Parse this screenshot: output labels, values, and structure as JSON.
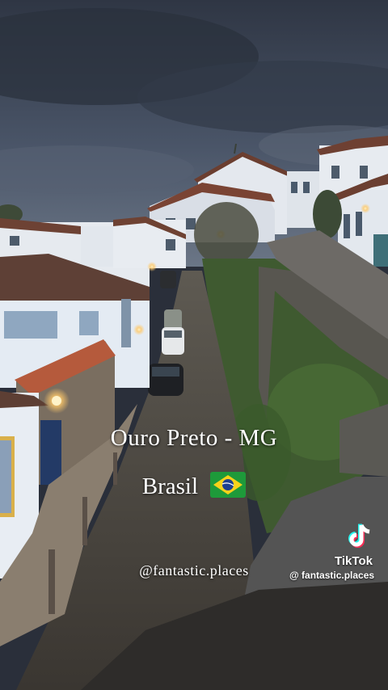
{
  "overlay": {
    "title": "Ouro Preto - MG",
    "country": "Brasil",
    "flag_icon": "brazil-flag-emoji",
    "handle": "@fantastic.places"
  },
  "watermark": {
    "brand": "TikTok",
    "username": "@ fantastic.places",
    "logo_icon": "tiktok-logo"
  },
  "colors": {
    "sky": "#3a4658",
    "wall_white": "#e9eef4",
    "roof_tile": "#7a4a38",
    "stone": "#5a5650",
    "lamp_glow": "#ffce7a"
  }
}
